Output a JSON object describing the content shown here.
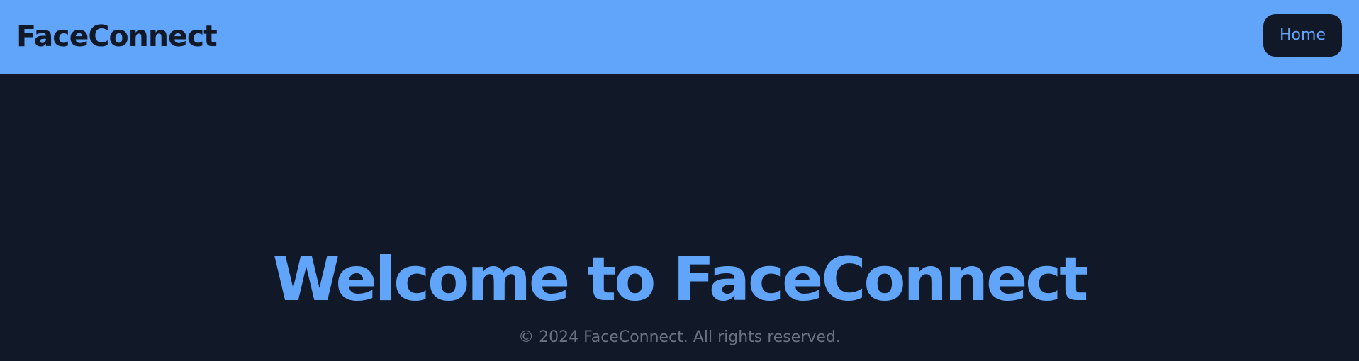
{
  "navbar": {
    "brand": "FaceConnect",
    "home_label": "Home"
  },
  "hero": {
    "title": "Welcome to FaceConnect"
  },
  "footer": {
    "copyright": "© 2024 FaceConnect. All rights reserved."
  },
  "colors": {
    "background": "#111827",
    "navbar": "#60a5fa",
    "accent": "#60a5fa",
    "muted_text": "#6b7280"
  }
}
